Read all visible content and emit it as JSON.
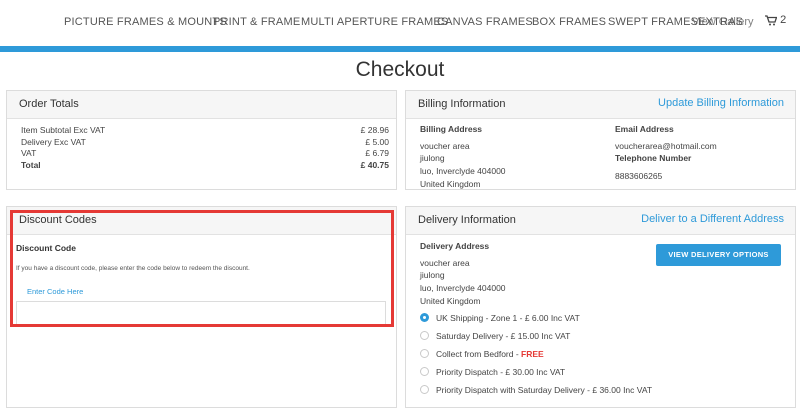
{
  "nav": {
    "items": [
      "PICTURE FRAMES & MOUNTS",
      "PRINT & FRAME",
      "MULTI APERTURE FRAMES",
      "CANVAS FRAMES",
      "BOX FRAMES",
      "SWEPT FRAMES",
      "EXTRAS"
    ],
    "overlap_label": "View Gallery",
    "basket_count": "2"
  },
  "page_title": "Checkout",
  "order_totals": {
    "title": "Order Totals",
    "rows": [
      {
        "label": "Item Subtotal Exc VAT",
        "value": "£ 28.96"
      },
      {
        "label": "Delivery Exc VAT",
        "value": "£ 5.00"
      },
      {
        "label": "VAT",
        "value": "£ 6.79"
      },
      {
        "label": "Total",
        "value": "£ 40.75"
      }
    ]
  },
  "billing": {
    "title": "Billing Information",
    "update_link": "Update Billing Information",
    "address_label": "Billing Address",
    "address_lines": [
      "voucher area",
      "jiulong",
      "luo, Inverclyde 404000",
      "United Kingdom"
    ],
    "email_label": "Email Address",
    "email": "voucherarea@hotmail.com",
    "phone_label": "Telephone Number",
    "phone": "8883606265"
  },
  "discount": {
    "title": "Discount Codes",
    "label": "Discount Code",
    "help": "If you have a discount code, please enter the code below to redeem the discount.",
    "placeholder": "Enter Code Here",
    "value": ""
  },
  "delivery": {
    "title": "Delivery Information",
    "alt_link": "Deliver to a Different Address",
    "address_label": "Delivery Address",
    "address_lines": [
      "voucher area",
      "jiulong",
      "luo, Inverclyde 404000",
      "United Kingdom"
    ],
    "button_label": "VIEW DELIVERY OPTIONS",
    "options": [
      {
        "label": "UK Shipping - Zone 1 - £ 6.00 Inc VAT",
        "selected": true
      },
      {
        "label": "Saturday Delivery - £ 15.00 Inc VAT",
        "selected": false
      },
      {
        "label": "Collect from Bedford - ",
        "badge": "FREE",
        "selected": false
      },
      {
        "label": "Priority Dispatch - £ 30.00 Inc VAT",
        "selected": false
      },
      {
        "label": "Priority Dispatch with Saturday Delivery - £ 36.00 Inc VAT",
        "selected": false
      }
    ]
  },
  "colors": {
    "accent": "#2e9ad9",
    "highlight": "#e53935",
    "free": "#e53935"
  }
}
